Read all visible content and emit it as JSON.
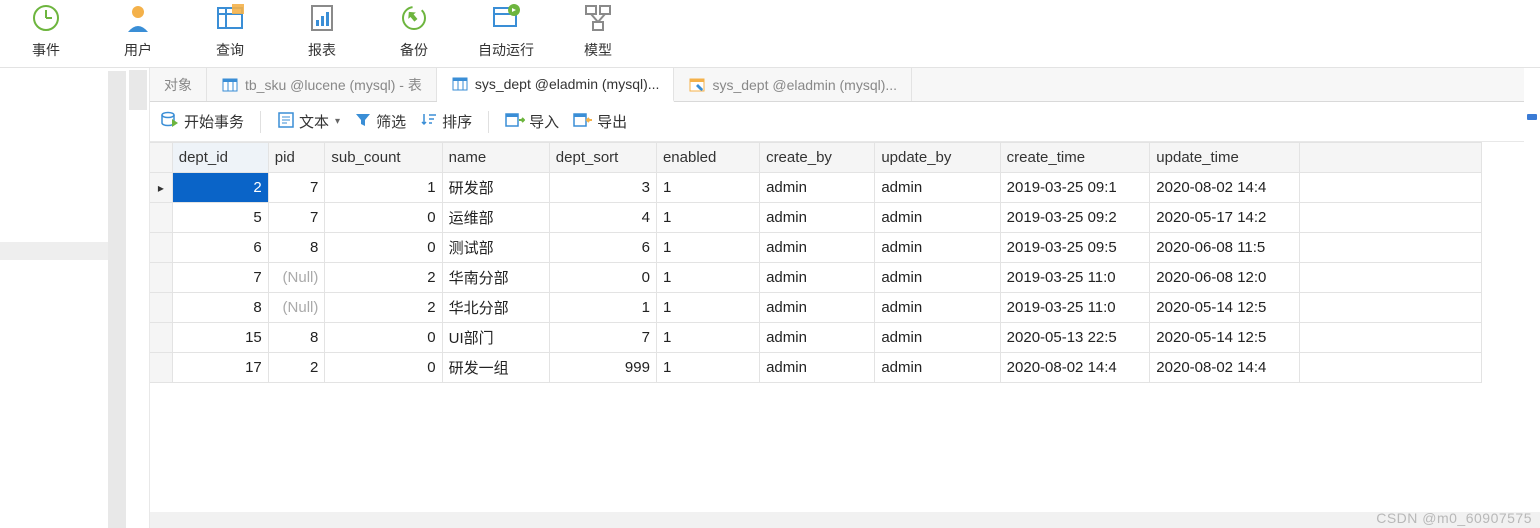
{
  "main_toolbar": {
    "items": [
      {
        "label": "事件",
        "icon": "clock"
      },
      {
        "label": "用户",
        "icon": "user"
      },
      {
        "label": "查询",
        "icon": "table"
      },
      {
        "label": "报表",
        "icon": "report"
      },
      {
        "label": "备份",
        "icon": "backup"
      },
      {
        "label": "自动运行",
        "icon": "autorun"
      },
      {
        "label": "模型",
        "icon": "model"
      }
    ]
  },
  "tabs": {
    "items": [
      {
        "label": "对象",
        "icon": "none",
        "active": false
      },
      {
        "label": "tb_sku @lucene (mysql) - 表",
        "icon": "table",
        "active": false
      },
      {
        "label": "sys_dept @eladmin (mysql)...",
        "icon": "table",
        "active": true
      },
      {
        "label": "sys_dept @eladmin (mysql)...",
        "icon": "edit-table",
        "active": false
      }
    ]
  },
  "sub_toolbar": {
    "begin_tx": "开始事务",
    "text": "文本",
    "filter": "筛选",
    "sort": "排序",
    "import": "导入",
    "export": "导出"
  },
  "columns": [
    "dept_id",
    "pid",
    "sub_count",
    "name",
    "dept_sort",
    "enabled",
    "create_by",
    "update_by",
    "create_time",
    "update_time"
  ],
  "rows": [
    {
      "dept_id": "2",
      "pid": "7",
      "sub_count": "1",
      "name": "研发部",
      "dept_sort": "3",
      "enabled": "1",
      "create_by": "admin",
      "update_by": "admin",
      "create_time": "2019-03-25 09:1",
      "update_time": "2020-08-02 14:4",
      "current": true
    },
    {
      "dept_id": "5",
      "pid": "7",
      "sub_count": "0",
      "name": "运维部",
      "dept_sort": "4",
      "enabled": "1",
      "create_by": "admin",
      "update_by": "admin",
      "create_time": "2019-03-25 09:2",
      "update_time": "2020-05-17 14:2"
    },
    {
      "dept_id": "6",
      "pid": "8",
      "sub_count": "0",
      "name": "测试部",
      "dept_sort": "6",
      "enabled": "1",
      "create_by": "admin",
      "update_by": "admin",
      "create_time": "2019-03-25 09:5",
      "update_time": "2020-06-08 11:5"
    },
    {
      "dept_id": "7",
      "pid": "(Null)",
      "pid_null": true,
      "sub_count": "2",
      "name": "华南分部",
      "dept_sort": "0",
      "enabled": "1",
      "create_by": "admin",
      "update_by": "admin",
      "create_time": "2019-03-25 11:0",
      "update_time": "2020-06-08 12:0"
    },
    {
      "dept_id": "8",
      "pid": "(Null)",
      "pid_null": true,
      "sub_count": "2",
      "name": "华北分部",
      "dept_sort": "1",
      "enabled": "1",
      "create_by": "admin",
      "update_by": "admin",
      "create_time": "2019-03-25 11:0",
      "update_time": "2020-05-14 12:5"
    },
    {
      "dept_id": "15",
      "pid": "8",
      "sub_count": "0",
      "name": "UI部门",
      "dept_sort": "7",
      "enabled": "1",
      "create_by": "admin",
      "update_by": "admin",
      "create_time": "2020-05-13 22:5",
      "update_time": "2020-05-14 12:5"
    },
    {
      "dept_id": "17",
      "pid": "2",
      "sub_count": "0",
      "name": "研发一组",
      "dept_sort": "999",
      "enabled": "1",
      "create_by": "admin",
      "update_by": "admin",
      "create_time": "2020-08-02 14:4",
      "update_time": "2020-08-02 14:4"
    }
  ],
  "watermark": "CSDN @m0_60907575"
}
